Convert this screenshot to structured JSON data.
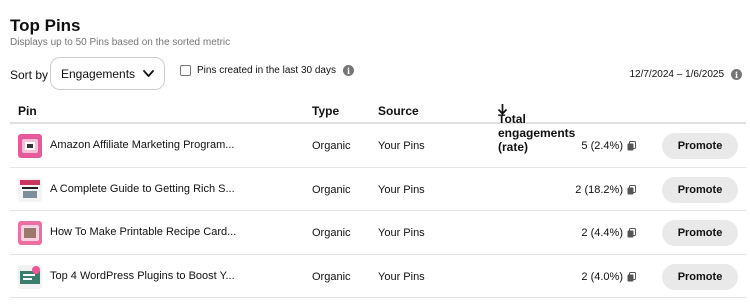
{
  "header": {
    "title": "Top Pins",
    "subtitle": "Displays up to 50 Pins based on the sorted metric"
  },
  "controls": {
    "sort_label": "Sort by",
    "sort_value": "Engagements",
    "checkbox_label": "Pins created in the last 30 days",
    "checkbox_checked": false,
    "date_range": "12/7/2024 – 1/6/2025"
  },
  "table": {
    "headers": {
      "pin": "Pin",
      "type": "Type",
      "source": "Source",
      "engagements": "Total engagements (rate)"
    },
    "sort_direction": "descending",
    "rows": [
      {
        "title": "Amazon Affiliate Marketing Program...",
        "type": "Organic",
        "source": "Your Pins",
        "engagements": "5 (2.4%)",
        "action": "Promote"
      },
      {
        "title": "A Complete Guide to Getting Rich S...",
        "type": "Organic",
        "source": "Your Pins",
        "engagements": "2 (18.2%)",
        "action": "Promote"
      },
      {
        "title": "How To Make Printable Recipe Card...",
        "type": "Organic",
        "source": "Your Pins",
        "engagements": "2 (4.4%)",
        "action": "Promote"
      },
      {
        "title": "Top 4 WordPress Plugins to Boost Y...",
        "type": "Organic",
        "source": "Your Pins",
        "engagements": "2 (4.0%)",
        "action": "Promote"
      }
    ]
  },
  "icons": {
    "info": "info-circle-icon",
    "chevron": "chevron-down-icon",
    "sort_arrow": "arrow-down-icon",
    "copy": "copy-icon"
  },
  "colors": {
    "text_primary": "#111111",
    "text_secondary": "#767676",
    "button_bg": "#e9e9e9",
    "border": "#cdcdcd"
  }
}
